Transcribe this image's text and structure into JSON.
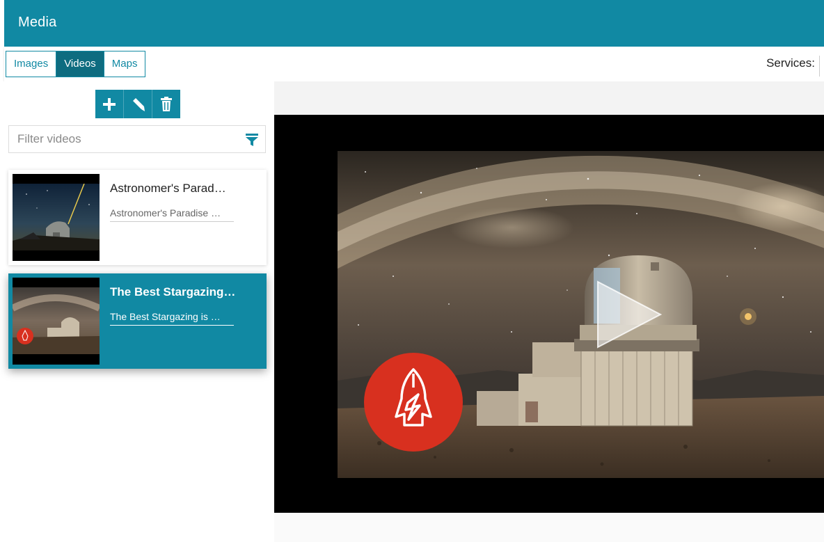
{
  "header": {
    "title": "Media"
  },
  "tabs": [
    {
      "label": "Images",
      "active": false
    },
    {
      "label": "Videos",
      "active": true
    },
    {
      "label": "Maps",
      "active": false
    }
  ],
  "services": {
    "label": "Services:"
  },
  "actions": {
    "add_icon": "plus-icon",
    "edit_icon": "pencil-icon",
    "delete_icon": "trash-icon"
  },
  "filter": {
    "placeholder": "Filter videos",
    "icon": "filter-icon"
  },
  "videos": [
    {
      "title": "Astronomer's Parad…",
      "description": "Astronomer's Paradise …",
      "selected": false
    },
    {
      "title": "The Best Stargazing…",
      "description": "The Best Stargazing is …",
      "selected": true
    }
  ],
  "player": {
    "play_icon": "play-icon",
    "channel_logo": "rocket-logo-icon"
  },
  "colors": {
    "accent": "#1189a3",
    "accent_dark": "#0e6c80",
    "logo_red": "#d8301f"
  }
}
